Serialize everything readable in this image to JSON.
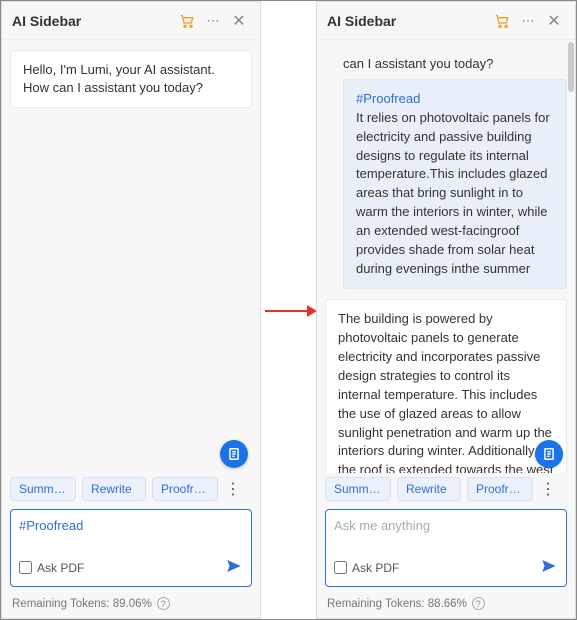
{
  "left": {
    "title": "AI Sidebar",
    "greeting": "Hello, I'm Lumi, your AI assistant. How can I assistant you today?",
    "chips": {
      "summarize": "Summar...",
      "rewrite": "Rewrite",
      "proofread": "Proofre..."
    },
    "input_value": "#Proofread",
    "askpdf": "Ask PDF",
    "tokens_label": "Remaining Tokens: 89.06%"
  },
  "right": {
    "title": "AI Sidebar",
    "partial_greeting": "can I assistant you today?",
    "user_tag": "#Proofread",
    "user_body": "It relies on photovoltaic panels for electricity and passive building designs to regulate its internal temperature.This includes glazed areas that bring sunlight in to warm the interiors in winter, while an extended west-facingroof provides shade from solar heat during evenings inthe summer",
    "ai_reply": "The building is powered by photovoltaic panels to generate electricity and incorporates passive design strategies to control its internal temperature. This includes the use of glazed areas to allow sunlight penetration and warm up the interiors during winter. Additionally, the roof is extended towards the west side to provide shade against solar heat in the evenings during summer.",
    "chips": {
      "summarize": "Summar...",
      "rewrite": "Rewrite",
      "proofread": "Proofre..."
    },
    "input_placeholder": "Ask me anything",
    "askpdf": "Ask PDF",
    "tokens_label": "Remaining Tokens: 88.66%"
  }
}
